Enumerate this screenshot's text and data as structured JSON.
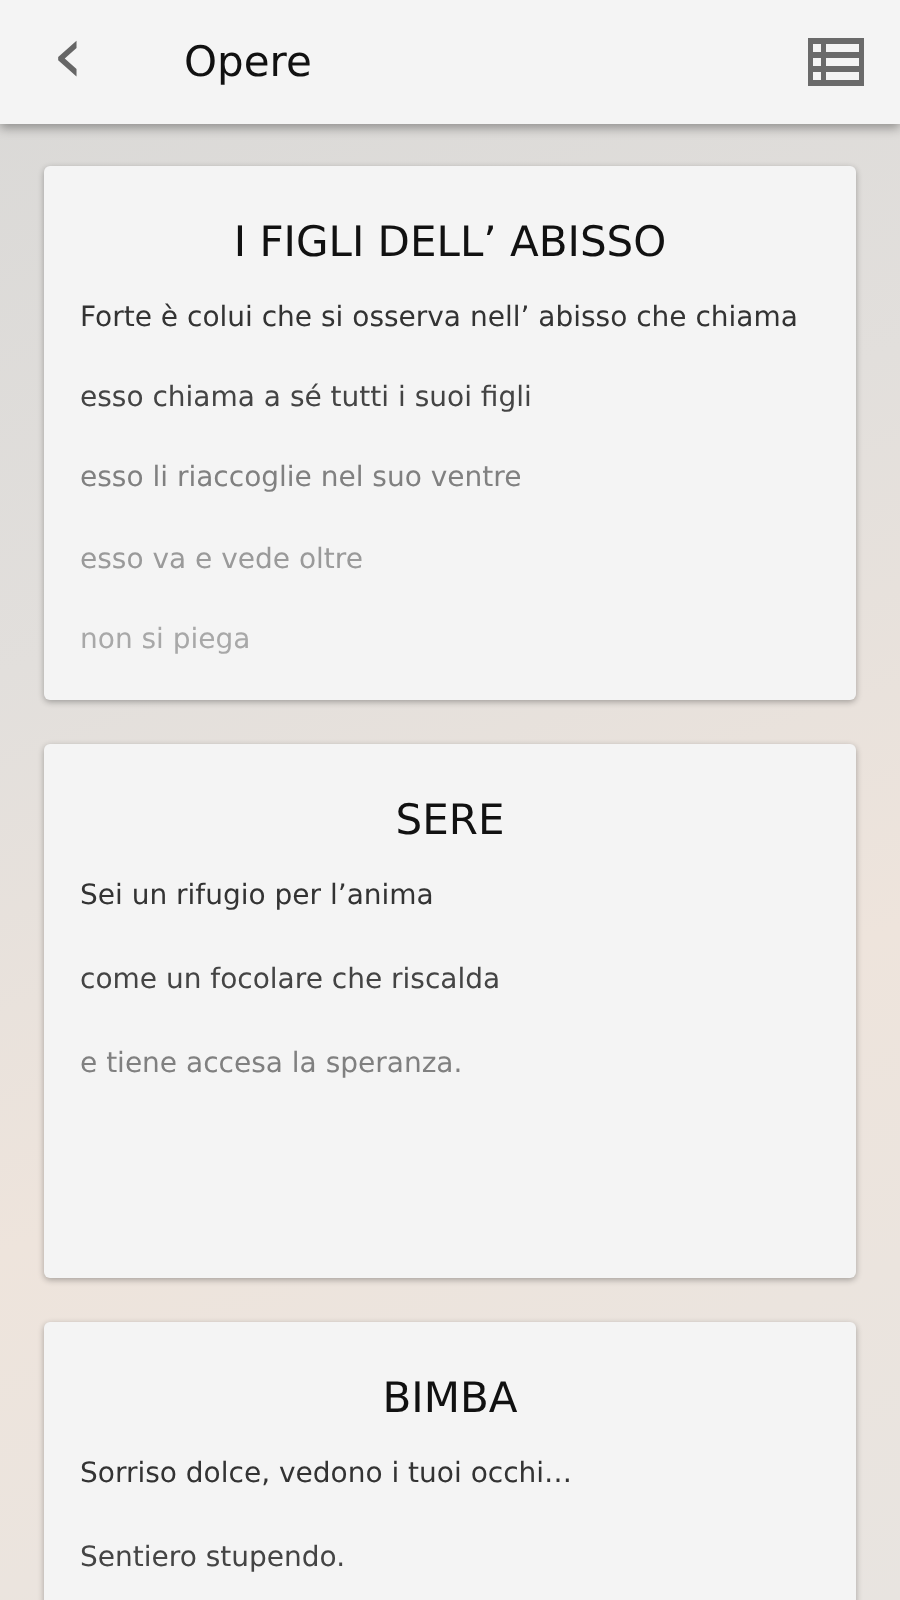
{
  "header": {
    "back": "‹",
    "title": "Opere"
  },
  "poems": [
    {
      "title": "I FIGLI DELL’ ABISSO",
      "lines": [
        "Forte è colui che si osserva nell’ abisso che chiama",
        "esso chiama a sé tutti i suoi figli",
        "esso li riaccoglie nel suo ventre",
        "esso va e vede oltre",
        "non si piega"
      ]
    },
    {
      "title": "SERE",
      "lines": [
        "Sei un rifugio per l’anima",
        "come un focolare che riscalda",
        "e tiene accesa la speranza."
      ]
    },
    {
      "title": "BIMBA",
      "lines": [
        "Sorriso dolce, vedono i tuoi occhi…",
        "Sentiero stupendo."
      ]
    }
  ]
}
